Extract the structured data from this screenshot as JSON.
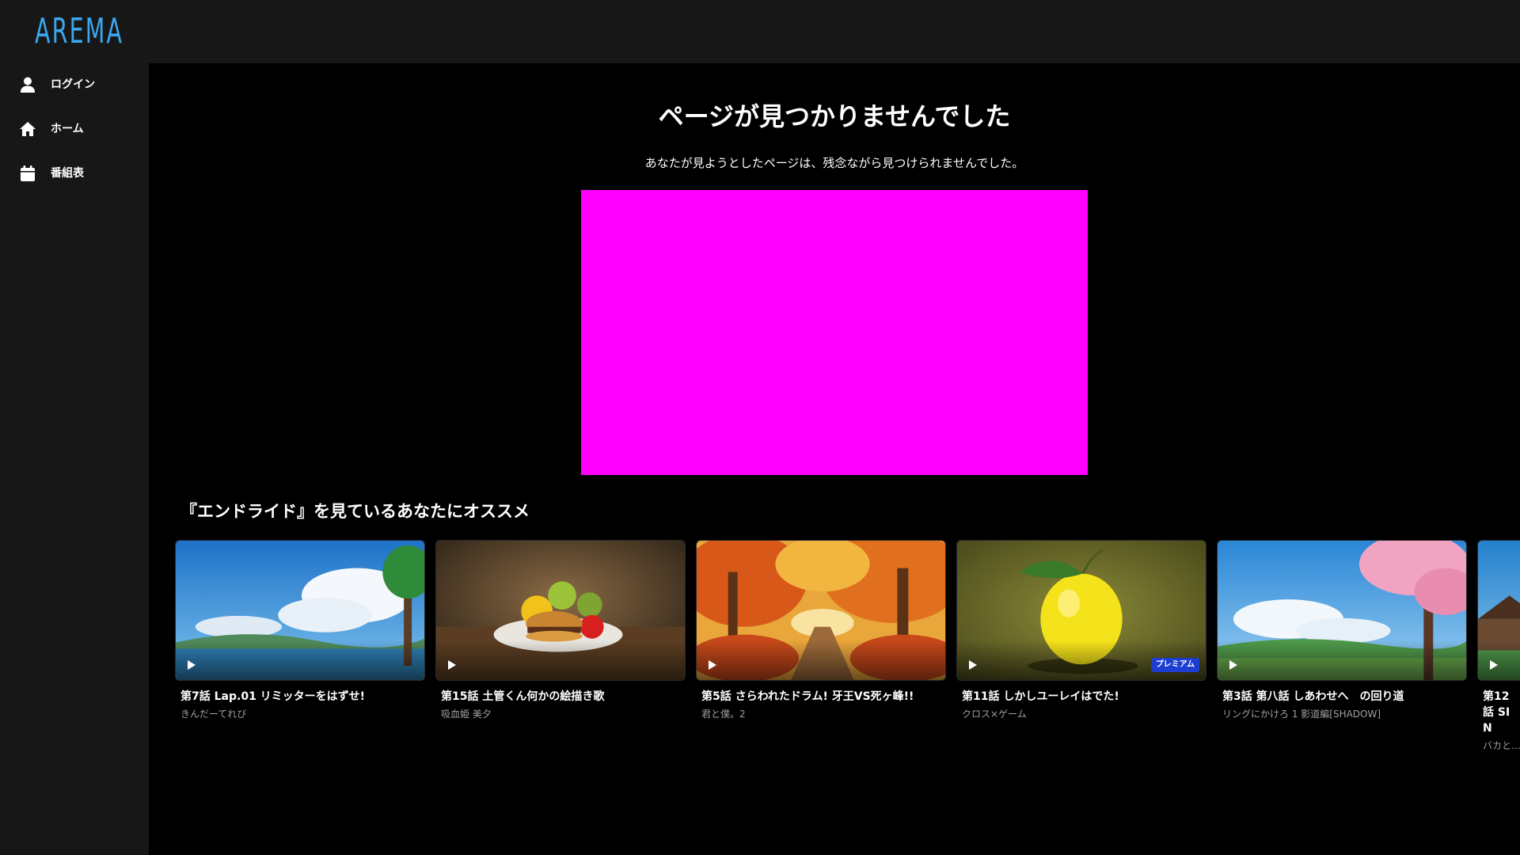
{
  "app": {
    "logo_text": "AREMA"
  },
  "sidebar": {
    "items": [
      {
        "label": "ログイン",
        "icon": "user-icon"
      },
      {
        "label": "ホーム",
        "icon": "home-icon"
      },
      {
        "label": "番組表",
        "icon": "calendar-icon"
      }
    ]
  },
  "main": {
    "title": "ページが見つかりませんでした",
    "message": "あなたが見ようとしたページは、残念ながら見つけられませんでした。",
    "video_placeholder_color": "#ff00ff"
  },
  "recommend": {
    "heading": "『エンドライド』を見ているあなたにオススメ",
    "cards": [
      {
        "title": "第7話 Lap.01 リミッターをはずせ!",
        "series": "きんだーてれび",
        "badge": ""
      },
      {
        "title": "第15話 土管くん何かの絵描き歌",
        "series": "吸血姫 美夕",
        "badge": ""
      },
      {
        "title": "第5話 さらわれたドラム! 牙王VS死ヶ峰!!",
        "series": "君と僕。2",
        "badge": ""
      },
      {
        "title": "第11話 しかしユーレイはでた!",
        "series": "クロス×ゲーム",
        "badge": "プレミアム"
      },
      {
        "title": "第3話 第八話 しあわせへ　の回り道",
        "series": "リングにかけろ 1 影道編[SHADOW]",
        "badge": ""
      },
      {
        "title": "第12話 SIN",
        "series": "バカと…",
        "badge": ""
      }
    ]
  },
  "colors": {
    "accent": "#3aa8f0",
    "premium_badge": "#1d3ed0",
    "sidebar_bg": "#171717"
  }
}
